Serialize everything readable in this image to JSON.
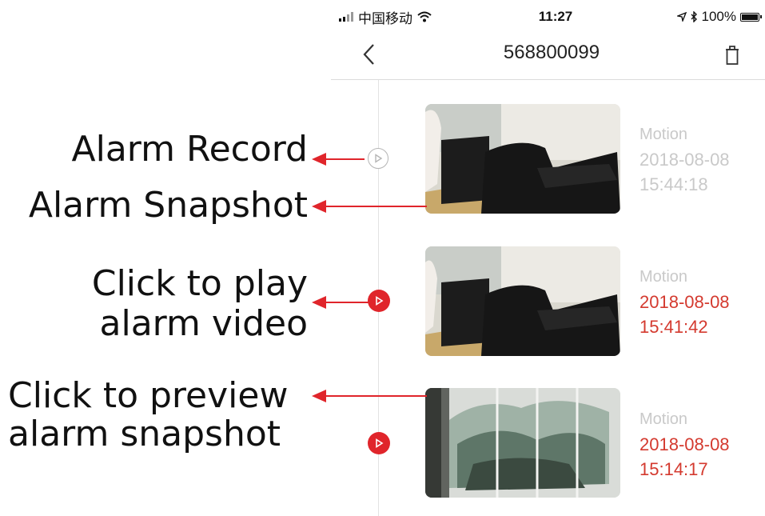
{
  "status_bar": {
    "carrier": "中国移动",
    "time": "11:27",
    "battery": "100%"
  },
  "nav": {
    "title": "568800099"
  },
  "records": [
    {
      "type": "Motion",
      "date": "2018-08-08",
      "time": "15:44:18",
      "viewed": true
    },
    {
      "type": "Motion",
      "date": "2018-08-08",
      "time": "15:41:42",
      "viewed": false
    },
    {
      "type": "Motion",
      "date": "2018-08-08",
      "time": "15:14:17",
      "viewed": false
    }
  ],
  "annotations": {
    "alarm_record": "Alarm Record",
    "alarm_snapshot": "Alarm Snapshot",
    "click_play_line1": "Click to play",
    "click_play_line2": "alarm  video",
    "click_preview_line1": "Click to preview",
    "click_preview_line2": "alarm snapshot"
  },
  "colors": {
    "accent_red": "#e0252b",
    "text_red": "#d43a2f",
    "muted_grey": "#c9c9c9"
  },
  "icons": [
    "signal-icon",
    "wifi-icon",
    "location-arrow-icon",
    "bluetooth-icon",
    "battery-icon",
    "back-chevron-icon",
    "trash-icon",
    "play-outline-icon",
    "play-filled-icon"
  ]
}
